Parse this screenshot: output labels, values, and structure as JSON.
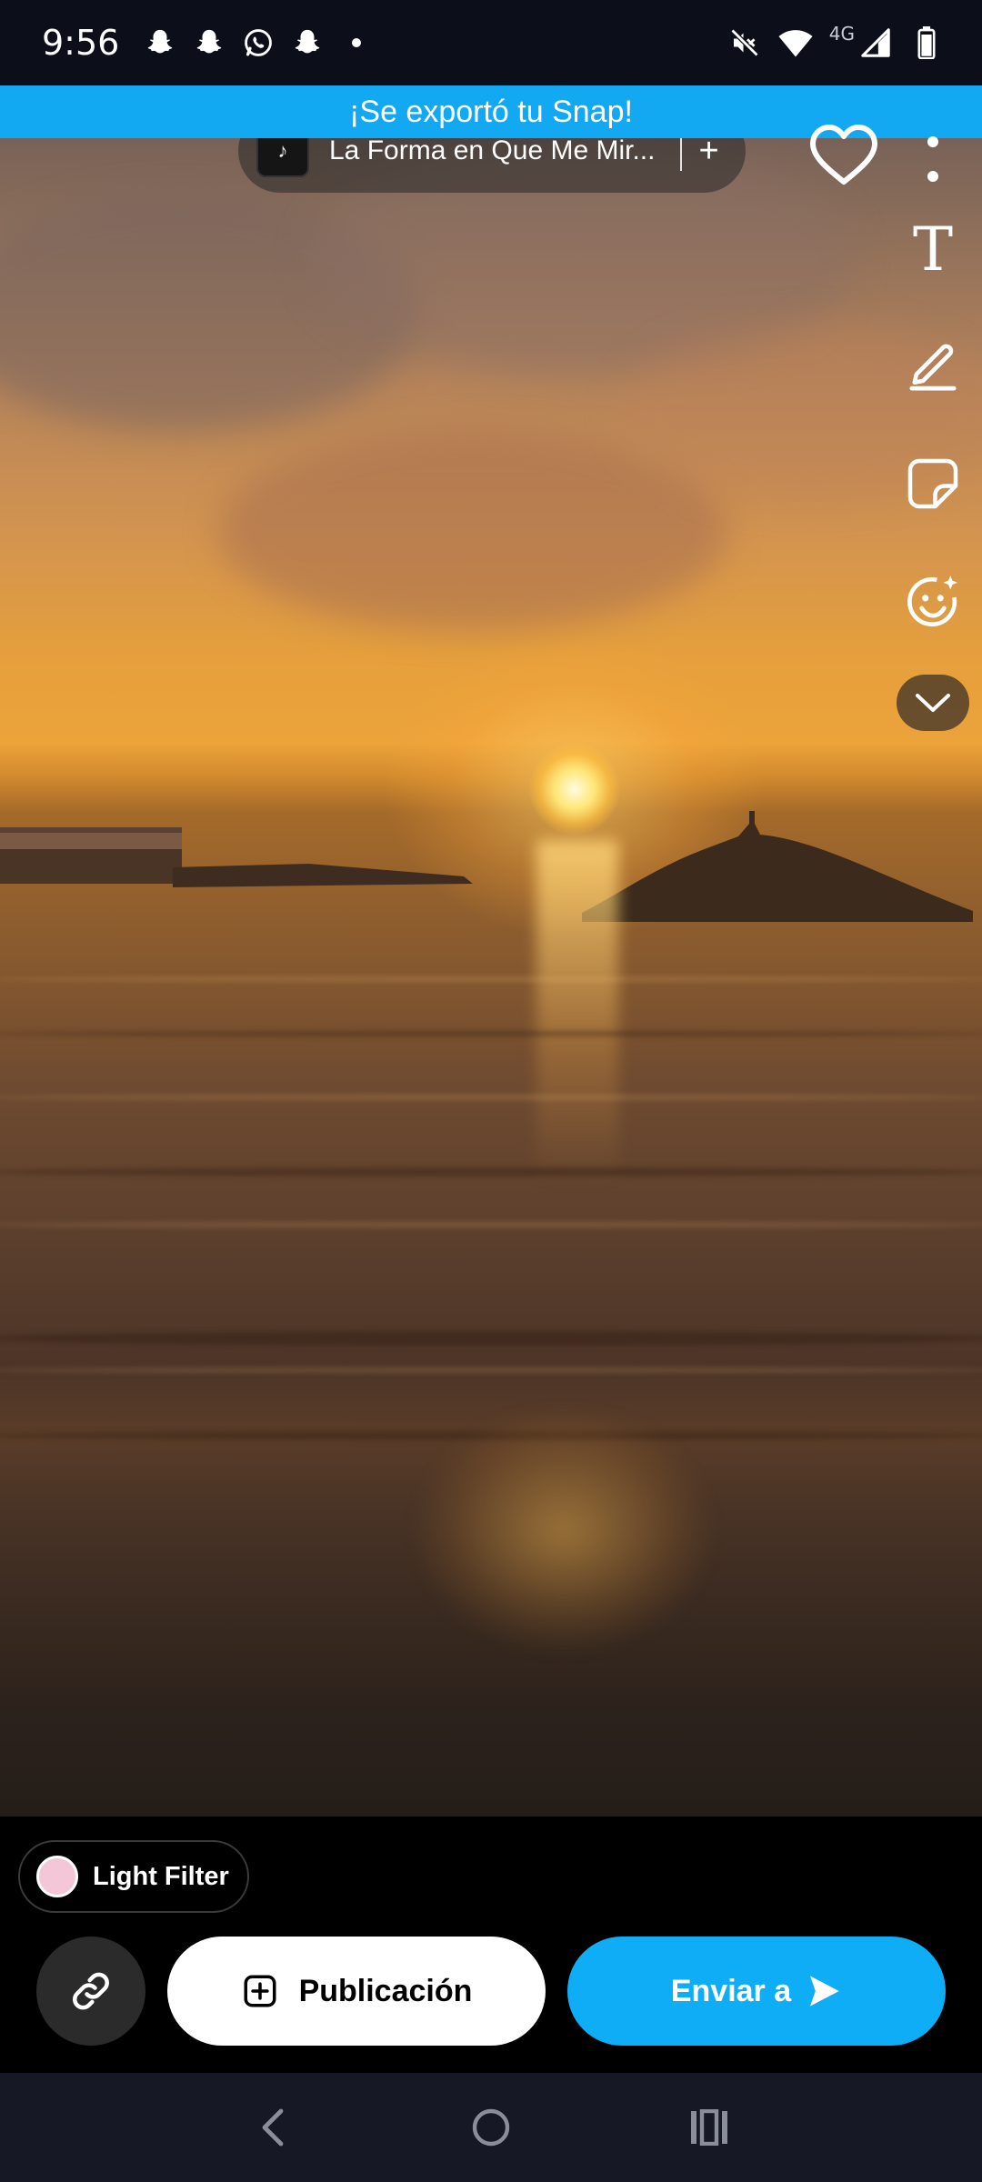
{
  "status_bar": {
    "time": "9:56",
    "notification_icons": [
      "snapchat-icon",
      "snapchat-icon",
      "whatsapp-icon",
      "snapchat-icon",
      "dot-icon"
    ],
    "network_label": "4G",
    "system_icons": [
      "mute-icon",
      "wifi-icon",
      "signal-icon",
      "battery-icon"
    ]
  },
  "banner": {
    "text": "¡Se exportó tu Snap!",
    "color": "#12a8f2"
  },
  "music": {
    "title": "La Forma en Que Me Mir...",
    "add_symbol": "+"
  },
  "tools": {
    "text_tool_glyph": "T",
    "items": [
      "heart-icon",
      "more-icon",
      "text-tool-icon",
      "pencil-icon",
      "sticker-icon",
      "emoji-sparkle-icon",
      "chevron-down-icon"
    ]
  },
  "filter": {
    "label": "Light Filter",
    "swatch_color": "#f3c6d8"
  },
  "actions": {
    "link_icon": "link-icon",
    "post_label": "Publicación",
    "send_label": "Enviar a",
    "send_color": "#0fadf5"
  },
  "nav": [
    "back-icon",
    "home-icon",
    "recents-icon"
  ]
}
